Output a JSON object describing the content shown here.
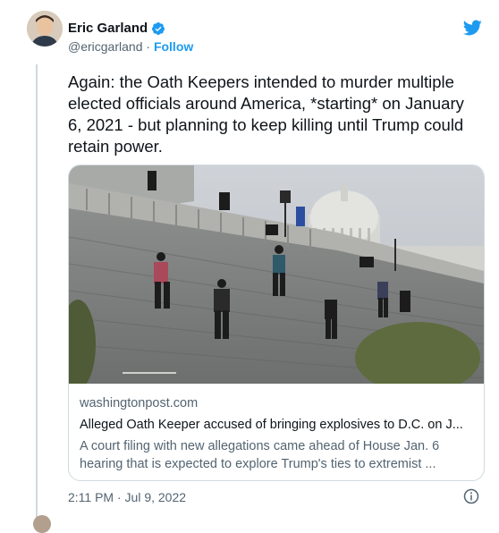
{
  "author": {
    "name": "Eric Garland",
    "handle": "@ericgarland",
    "separator": "·",
    "follow_label": "Follow"
  },
  "tweet": {
    "text": "Again: the Oath Keepers intended to murder multiple elected officials around America, *starting* on January 6, 2021 - but planning to keep killing until Trump could retain power.",
    "timestamp": "2:11 PM · Jul 9, 2022"
  },
  "card": {
    "domain": "washingtonpost.com",
    "headline": "Alleged Oath Keeper accused of bringing explosives to D.C. on J...",
    "description": "A court filing with new allegations came ahead of House Jan. 6 hearing that is expected to explore Trump's ties to extremist ..."
  },
  "icons": {
    "verified": "verified-badge-icon",
    "bird": "twitter-bird-icon",
    "info": "info-icon"
  },
  "colors": {
    "accent": "#1d9bf0",
    "text": "#0f1419",
    "muted": "#536471",
    "border": "#cfd9de"
  }
}
